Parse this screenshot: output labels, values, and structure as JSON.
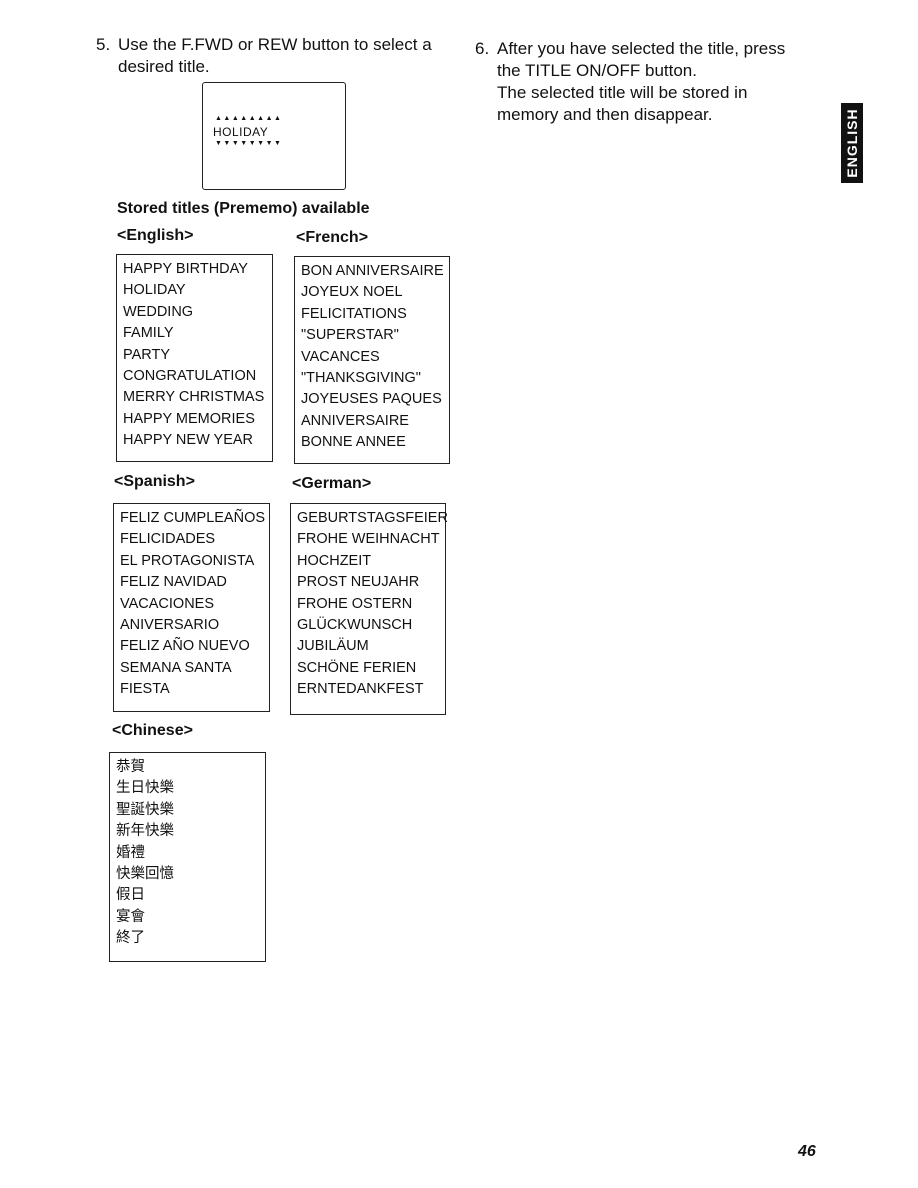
{
  "step5": {
    "number": "5.",
    "line1": "Use the F.FWD or REW button to select a",
    "line2": "desired title."
  },
  "display": {
    "text": "HOLIDAY",
    "markers_top": "▲▲▲▲▲▲▲▲",
    "markers_bottom": "▼▼▼▼▼▼▼▼"
  },
  "stored_heading": "Stored titles (Prememo) available",
  "lists": {
    "english": {
      "heading": "<English>",
      "items": [
        "HAPPY BIRTHDAY",
        "HOLIDAY",
        "WEDDING",
        "FAMILY",
        "PARTY",
        "CONGRATULATION",
        "MERRY CHRISTMAS",
        "HAPPY MEMORIES",
        "HAPPY NEW YEAR"
      ]
    },
    "french": {
      "heading": "<French>",
      "items": [
        "BON ANNIVERSAIRE",
        "JOYEUX NOEL",
        "FELICITATIONS",
        "\"SUPERSTAR\"",
        "VACANCES",
        "\"THANKSGIVING\"",
        "JOYEUSES PAQUES",
        "ANNIVERSAIRE",
        "BONNE ANNEE"
      ]
    },
    "spanish": {
      "heading": "<Spanish>",
      "items": [
        "FELIZ CUMPLEAÑOS",
        "FELICIDADES",
        "EL PROTAGONISTA",
        "FELIZ NAVIDAD",
        "VACACIONES",
        "ANIVERSARIO",
        "FELIZ AÑO NUEVO",
        "SEMANA SANTA",
        "FIESTA"
      ]
    },
    "german": {
      "heading": "<German>",
      "items": [
        "GEBURTSTAGSFEIER",
        "FROHE WEIHNACHT",
        "HOCHZEIT",
        "PROST NEUJAHR",
        "FROHE OSTERN",
        "GLÜCKWUNSCH",
        "JUBILÄUM",
        "SCHÖNE FERIEN",
        "ERNTEDANKFEST"
      ]
    },
    "chinese": {
      "heading": "<Chinese>",
      "items": [
        "恭賀",
        "生日快樂",
        "聖誕快樂",
        "新年快樂",
        "婚禮",
        "快樂回憶",
        "假日",
        "宴會",
        "終了"
      ]
    }
  },
  "step6": {
    "number": "6.",
    "line1": "After you have selected the title, press",
    "line2": "the TITLE ON/OFF button.",
    "line3": "The selected title will be stored in",
    "line4": "memory and then disappear."
  },
  "side_tab": "ENGLISH",
  "page_number": "46"
}
